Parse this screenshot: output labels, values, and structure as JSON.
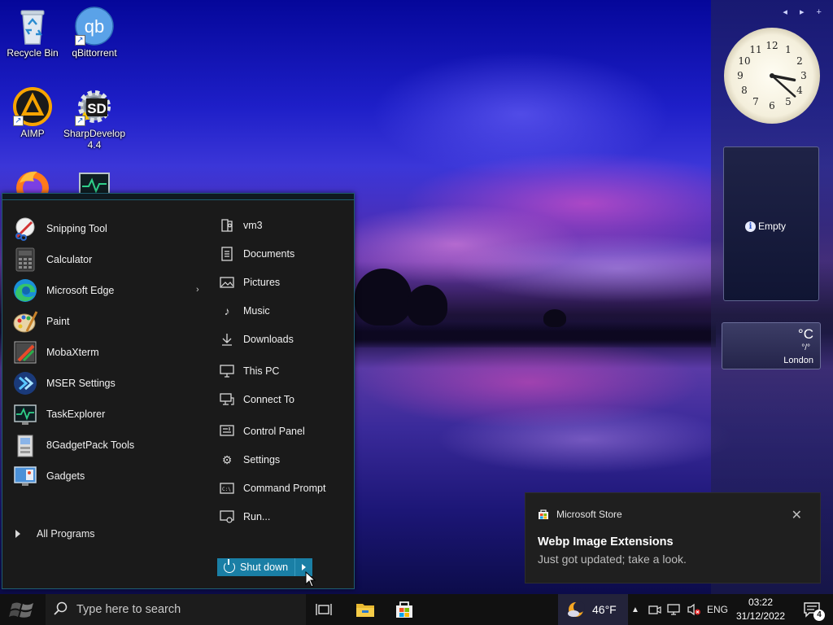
{
  "desktop": {
    "icons": [
      {
        "label": "Recycle Bin",
        "icon": "recycle-bin-icon"
      },
      {
        "label": "qBittorrent",
        "icon": "qbittorrent-icon"
      },
      {
        "label": "AIMP",
        "icon": "aimp-icon"
      },
      {
        "label": "SharpDevelop 4.4",
        "icon": "sharpdevelop-icon"
      },
      {
        "label": "",
        "icon": "firefox-icon"
      },
      {
        "label": "",
        "icon": "taskexplorer-icon"
      }
    ]
  },
  "sidebar": {
    "nav": "◂ ▸ +",
    "empty_gadget": {
      "text": "Empty"
    },
    "weather": {
      "unit": "°C",
      "value": "°/°",
      "city": "London"
    },
    "clock": {
      "hour": 3,
      "minute": 22
    }
  },
  "start_menu": {
    "left_items": [
      {
        "label": "Snipping Tool",
        "icon": "snipping-tool-icon"
      },
      {
        "label": "Calculator",
        "icon": "calculator-icon"
      },
      {
        "label": "Microsoft Edge",
        "icon": "edge-icon",
        "has_submenu": true
      },
      {
        "label": "Paint",
        "icon": "paint-icon"
      },
      {
        "label": "MobaXterm",
        "icon": "mobaxterm-icon"
      },
      {
        "label": "MSER Settings",
        "icon": "mser-settings-icon"
      },
      {
        "label": "TaskExplorer",
        "icon": "taskexplorer-icon"
      },
      {
        "label": "8GadgetPack Tools",
        "icon": "gadgetpack-tools-icon"
      },
      {
        "label": "Gadgets",
        "icon": "gadgets-icon"
      }
    ],
    "all_programs": "All Programs",
    "right_items": [
      {
        "label": "vm3",
        "icon": "user-folder-icon"
      },
      {
        "label": "Documents",
        "icon": "document-icon"
      },
      {
        "label": "Pictures",
        "icon": "picture-icon"
      },
      {
        "label": "Music",
        "icon": "music-icon"
      },
      {
        "label": "Downloads",
        "icon": "download-icon"
      },
      {
        "label": "This PC",
        "icon": "computer-icon"
      },
      {
        "label": "Connect To",
        "icon": "connect-icon"
      },
      {
        "label": "Control Panel",
        "icon": "control-panel-icon"
      },
      {
        "label": "Settings",
        "icon": "gear-icon"
      },
      {
        "label": "Command Prompt",
        "icon": "command-prompt-icon"
      },
      {
        "label": "Run...",
        "icon": "run-icon"
      }
    ],
    "shutdown_label": "Shut down"
  },
  "toast": {
    "app": "Microsoft Store",
    "title": "Webp Image Extensions",
    "body": "Just got updated; take a look."
  },
  "taskbar": {
    "search_placeholder": "Type here to search",
    "weather_temp": "46°F",
    "language": "ENG",
    "time": "03:22",
    "date": "31/12/2022",
    "notification_count": "4"
  },
  "colors": {
    "accent": "#1a7fa5",
    "menu_bg": "#1a1a1a",
    "taskbar_bg": "#111111",
    "toast_bg": "#1f1f1f"
  }
}
